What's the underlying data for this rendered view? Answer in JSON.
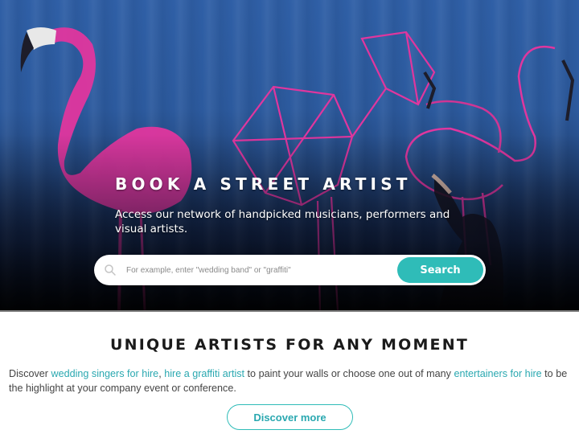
{
  "hero": {
    "title": "BOOK A STREET ARTIST",
    "subtitle": "Access our network of handpicked musicians, performers and visual artists.",
    "search": {
      "icon": "search-icon",
      "placeholder": "For example, enter \"wedding band\" or \"graffiti\"",
      "value": "",
      "button_label": "Search"
    }
  },
  "section": {
    "title": "UNIQUE ARTISTS FOR ANY MOMENT",
    "text": {
      "part1": "Discover ",
      "link1": "wedding singers for hire",
      "part2": ", ",
      "link2": "hire a graffiti artist",
      "part3": " to paint your walls or choose one out of many ",
      "link3": "entertainers for hire",
      "part4": " to be the highlight at your company event or conference."
    },
    "button_label": "Discover more"
  },
  "colors": {
    "accent": "#2fbcb8",
    "link": "#2aa8b0",
    "hero_blue": "#2f5fa6",
    "flamingo_pink": "#e0369e"
  }
}
